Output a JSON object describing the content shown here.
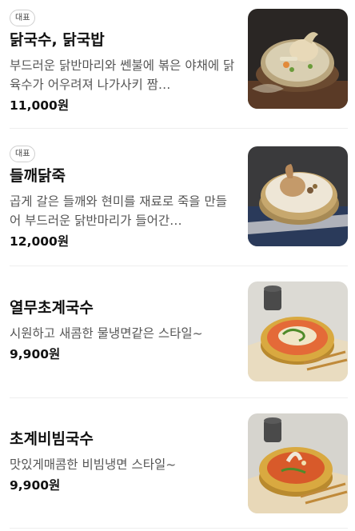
{
  "menu": {
    "items": [
      {
        "badge": "대표",
        "name": "닭국수, 닭국밥",
        "description": "부드러운 닭반마리와 쎈불에 볶은 야채에 닭육수가 어우려져 나가사키 짬…",
        "price": "11,000원",
        "image_icon": "chicken-noodle-soup-photo"
      },
      {
        "badge": "대표",
        "name": "들깨닭죽",
        "description": "곱게 갈은 들깨와 현미를 재료로 죽을 만들어 부드러운 닭반마리가 들어간…",
        "price": "12,000원",
        "image_icon": "perilla-chicken-porridge-photo"
      },
      {
        "badge": "",
        "name": "열무초계국수",
        "description": "시원하고 새콤한 물냉면같은 스타일~",
        "price": "9,900원",
        "image_icon": "cold-radish-noodle-photo"
      },
      {
        "badge": "",
        "name": "초계비빔국수",
        "description": "맛있게매콤한 비빔냉면 스타일~",
        "price": "9,900원",
        "image_icon": "spicy-mixed-noodle-photo"
      }
    ]
  }
}
